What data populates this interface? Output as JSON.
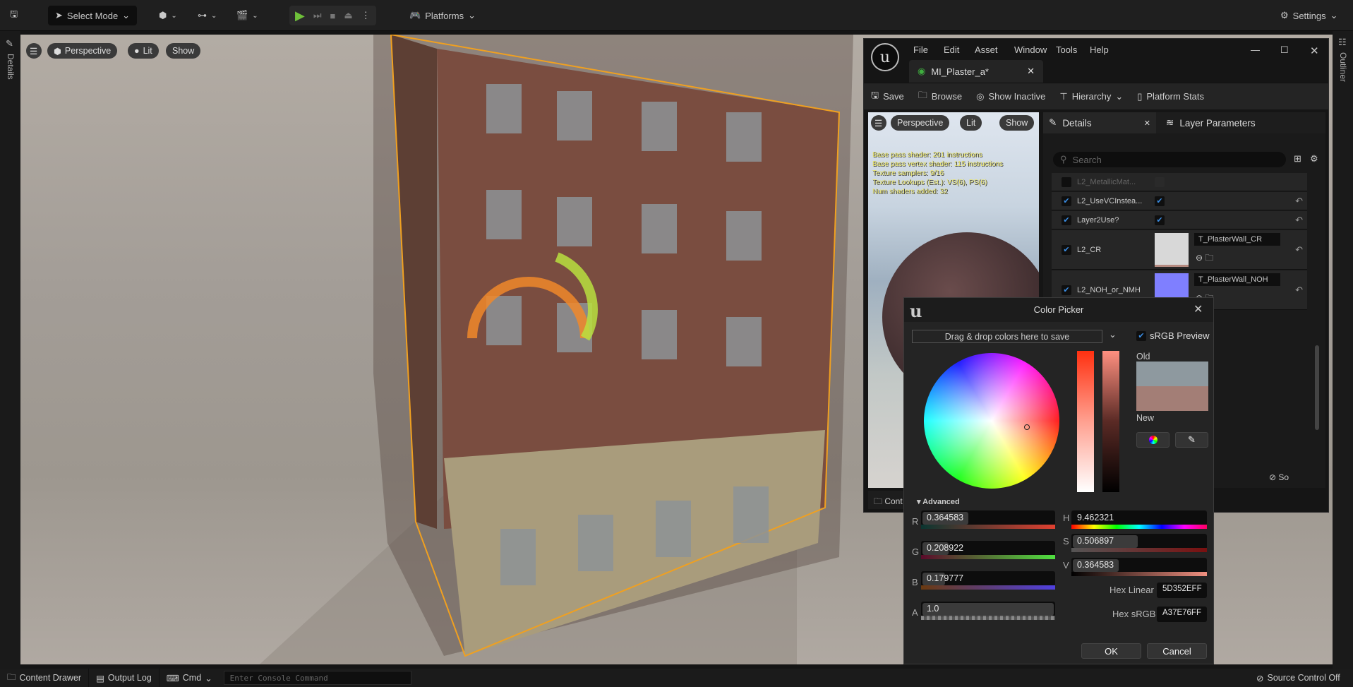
{
  "toolbar": {
    "select_mode": "Select Mode",
    "platforms": "Platforms",
    "settings": "Settings"
  },
  "viewport": {
    "perspective": "Perspective",
    "lit": "Lit",
    "show": "Show"
  },
  "side": {
    "left_tab": "Details",
    "right_tab": "Outliner"
  },
  "bottom": {
    "content_drawer": "Content Drawer",
    "output_log": "Output Log",
    "cmd": "Cmd",
    "console_placeholder": "Enter Console Command",
    "source_control": "Source Control Off"
  },
  "material_editor": {
    "menu": [
      "File",
      "Edit",
      "Asset",
      "Window",
      "Tools",
      "Help"
    ],
    "tab": "MI_Plaster_a*",
    "tools": {
      "save": "Save",
      "browse": "Browse",
      "show_inactive": "Show Inactive",
      "hierarchy": "Hierarchy",
      "platform_stats": "Platform Stats"
    },
    "preview": {
      "perspective": "Perspective",
      "lit": "Lit",
      "show": "Show",
      "stats": [
        "Base pass shader: 201 instructions",
        "Base pass vertex shader: 115 instructions",
        "Texture samplers: 9/16",
        "Texture Lookups (Est.): VS(6), PS(6)",
        "Num shaders added: 32"
      ],
      "content_trunc": "Cont"
    },
    "details": {
      "tab": "Details",
      "layer_tab": "Layer Parameters",
      "search_placeholder": "Search",
      "bottom_trunc": "So",
      "rows": [
        {
          "label": "L2_MetallicMat...",
          "checked": false
        },
        {
          "label": "L2_UseVCInstea...",
          "checked": true
        },
        {
          "label": "Layer2Use?",
          "checked": true
        },
        {
          "label": "L2_CR",
          "checked": true,
          "texture": "T_PlasterWall_CR",
          "swatch": "#d8d8d8"
        },
        {
          "label": "L2_NOH_or_NMH",
          "checked": true,
          "texture": "T_PlasterWall_NOH",
          "swatch": "#7f7fff"
        }
      ]
    }
  },
  "color_picker": {
    "title": "Color Picker",
    "drop_hint": "Drag & drop colors here to save",
    "srgb_preview": "sRGB Preview",
    "old_label": "Old",
    "new_label": "New",
    "old_color": "#8e999f",
    "new_color": "#a37e76",
    "advanced": "Advanced",
    "r_label": "R",
    "g_label": "G",
    "b_label": "B",
    "a_label": "A",
    "h_label": "H",
    "s_label": "S",
    "v_label": "V",
    "r": "0.364583",
    "g": "0.208922",
    "b": "0.179777",
    "a": "1.0",
    "h": "9.462321",
    "s": "0.506897",
    "v": "0.364583",
    "hex_linear_label": "Hex Linear",
    "hex_linear": "5D352EFF",
    "hex_srgb_label": "Hex sRGB",
    "hex_srgb": "A37E76FF",
    "ok": "OK",
    "cancel": "Cancel"
  }
}
